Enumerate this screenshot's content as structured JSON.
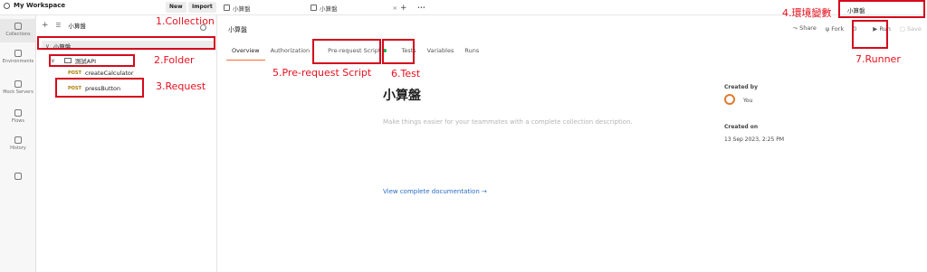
{
  "workspace": {
    "name": "My Workspace",
    "new_label": "New",
    "import_label": "Import"
  },
  "tabs": [
    {
      "label": "小算盤"
    },
    {
      "label": "小算盤"
    }
  ],
  "topbar": {
    "add_tab": "+",
    "more": "•••"
  },
  "environment": {
    "label": "小算盤"
  },
  "rail": [
    {
      "label": "Collections"
    },
    {
      "label": "Environments"
    },
    {
      "label": "Mock Servers"
    },
    {
      "label": "Flows"
    },
    {
      "label": "History"
    }
  ],
  "sidebar": {
    "add_label": "+",
    "filter_label": "小算盤",
    "collection": "小算盤",
    "folder": "測試API",
    "requests": [
      {
        "method": "POST",
        "name": "createCalculator"
      },
      {
        "method": "POST",
        "name": "pressButton"
      }
    ]
  },
  "main": {
    "title": "小算盤",
    "actions": {
      "share": "Share",
      "fork": "Fork",
      "fork_count": "0",
      "run": "Run",
      "save": "Save"
    },
    "subtabs": [
      "Overview",
      "Authorization",
      "Pre-request Script",
      "Tests",
      "Variables",
      "Runs"
    ],
    "collection_title": "小算盤",
    "description_placeholder": "Make things easier for your teammates with a complete collection description.",
    "view_docs": "View complete documentation →",
    "created_by_label": "Created by",
    "created_by_value": "You",
    "created_on_label": "Created on",
    "created_on_value": "13 Sep 2023, 2:25 PM"
  },
  "annotations": {
    "collection": "1.Collection",
    "folder": "2.Folder",
    "request": "3.Request",
    "env": "4.環境變數",
    "prerequest": "5.Pre-request Script",
    "test": "6.Test",
    "runner": "7.Runner"
  },
  "colors": {
    "annotation": "#e8111f",
    "accent": "#ff6c37",
    "link": "#2a6cca"
  }
}
